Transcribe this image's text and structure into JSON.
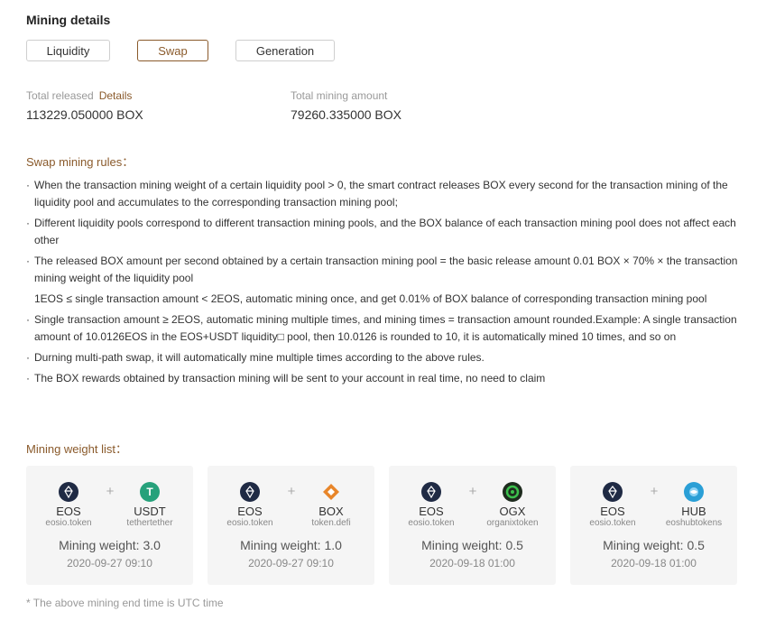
{
  "header": {
    "title": "Mining details"
  },
  "tabs": [
    {
      "label": "Liquidity",
      "active": false
    },
    {
      "label": "Swap",
      "active": true
    },
    {
      "label": "Generation",
      "active": false
    }
  ],
  "stats": {
    "total_released": {
      "label": "Total released",
      "link": "Details",
      "value": "113229.050000 BOX"
    },
    "total_mining": {
      "label": "Total mining amount",
      "value": "79260.335000 BOX"
    }
  },
  "rules": {
    "title": "Swap mining rules：",
    "items": [
      {
        "text": "When the transaction mining weight of a certain liquidity pool > 0, the smart contract releases BOX every second for the transaction mining of the liquidity pool and accumulates to the corresponding transaction mining pool;",
        "bullet": true
      },
      {
        "text": "Different liquidity pools correspond to different transaction mining pools, and the BOX balance of each transaction mining pool does not affect each other",
        "bullet": true
      },
      {
        "text": "The released BOX amount per second obtained by a certain transaction mining pool = the basic release amount 0.01 BOX × 70% × the transaction mining weight of the liquidity pool",
        "bullet": true
      },
      {
        "text": "1EOS ≤ single transaction amount < 2EOS, automatic mining once, and get 0.01% of BOX balance of corresponding transaction mining pool",
        "bullet": false
      },
      {
        "text": "Single transaction amount ≥ 2EOS, automatic mining multiple times, and mining times = transaction amount rounded.Example: A single transaction amount of 10.0126EOS in the EOS+USDT liquidity□ pool, then 10.0126 is rounded to 10, it is automatically mined 10 times, and so on",
        "bullet": true
      },
      {
        "text": "Durning multi-path swap, it will automatically mine multiple times according to the above rules.",
        "bullet": true
      },
      {
        "text": "The BOX rewards obtained by transaction mining will be sent to your account in real time, no need to claim",
        "bullet": true
      }
    ]
  },
  "weights": {
    "title": "Mining weight list：",
    "cards": [
      {
        "a": {
          "symbol": "EOS",
          "contract": "eosio.token",
          "icon": "eos-icon",
          "color": "#1f2a44"
        },
        "b": {
          "symbol": "USDT",
          "contract": "tethertether",
          "icon": "usdt-icon",
          "color": "#26a17b"
        },
        "weight": "Mining weight: 3.0",
        "time": "2020-09-27 09:10"
      },
      {
        "a": {
          "symbol": "EOS",
          "contract": "eosio.token",
          "icon": "eos-icon",
          "color": "#1f2a44"
        },
        "b": {
          "symbol": "BOX",
          "contract": "token.defi",
          "icon": "box-icon",
          "color": "#e8862a"
        },
        "weight": "Mining weight: 1.0",
        "time": "2020-09-27 09:10"
      },
      {
        "a": {
          "symbol": "EOS",
          "contract": "eosio.token",
          "icon": "eos-icon",
          "color": "#1f2a44"
        },
        "b": {
          "symbol": "OGX",
          "contract": "organixtoken",
          "icon": "ogx-icon",
          "color": "#2e9a3c"
        },
        "weight": "Mining weight: 0.5",
        "time": "2020-09-18 01:00"
      },
      {
        "a": {
          "symbol": "EOS",
          "contract": "eosio.token",
          "icon": "eos-icon",
          "color": "#1f2a44"
        },
        "b": {
          "symbol": "HUB",
          "contract": "eoshubtokens",
          "icon": "hub-icon",
          "color": "#2a9fd6"
        },
        "weight": "Mining weight: 0.5",
        "time": "2020-09-18 01:00"
      }
    ],
    "plus": "+"
  },
  "footnote": "* The above mining end time is UTC time"
}
